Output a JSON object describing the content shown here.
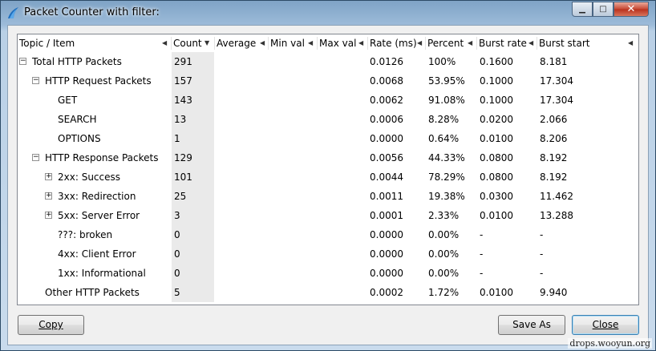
{
  "window": {
    "title": "Packet Counter with filter:",
    "controls": {
      "minimize": "▁",
      "maximize": "□",
      "close": "✕"
    }
  },
  "columns": [
    {
      "label": "Topic / Item"
    },
    {
      "label": "Count"
    },
    {
      "label": "Average"
    },
    {
      "label": "Min val"
    },
    {
      "label": "Max val"
    },
    {
      "label": "Rate (ms)"
    },
    {
      "label": "Percent"
    },
    {
      "label": "Burst rate"
    },
    {
      "label": "Burst start"
    }
  ],
  "rows": [
    {
      "expander": "minus",
      "topic": "Total HTTP Packets",
      "count": "291",
      "rate": "0.0126",
      "percent": "100%",
      "burst_rate": "0.1600",
      "burst_start": "8.181"
    },
    {
      "expander": "minus",
      "topic": "HTTP Request Packets",
      "count": "157",
      "rate": "0.0068",
      "percent": "53.95%",
      "burst_rate": "0.1000",
      "burst_start": "17.304"
    },
    {
      "expander": "",
      "topic": "GET",
      "count": "143",
      "rate": "0.0062",
      "percent": "91.08%",
      "burst_rate": "0.1000",
      "burst_start": "17.304"
    },
    {
      "expander": "",
      "topic": "SEARCH",
      "count": "13",
      "rate": "0.0006",
      "percent": "8.28%",
      "burst_rate": "0.0200",
      "burst_start": "2.066"
    },
    {
      "expander": "",
      "topic": "OPTIONS",
      "count": "1",
      "rate": "0.0000",
      "percent": "0.64%",
      "burst_rate": "0.0100",
      "burst_start": "8.206"
    },
    {
      "expander": "minus",
      "topic": "HTTP Response Packets",
      "count": "129",
      "rate": "0.0056",
      "percent": "44.33%",
      "burst_rate": "0.0800",
      "burst_start": "8.192"
    },
    {
      "expander": "plus",
      "topic": "2xx: Success",
      "count": "101",
      "rate": "0.0044",
      "percent": "78.29%",
      "burst_rate": "0.0800",
      "burst_start": "8.192"
    },
    {
      "expander": "plus",
      "topic": "3xx: Redirection",
      "count": "25",
      "rate": "0.0011",
      "percent": "19.38%",
      "burst_rate": "0.0300",
      "burst_start": "11.462"
    },
    {
      "expander": "plus",
      "topic": "5xx: Server Error",
      "count": "3",
      "rate": "0.0001",
      "percent": "2.33%",
      "burst_rate": "0.0100",
      "burst_start": "13.288"
    },
    {
      "expander": "",
      "topic": "???: broken",
      "count": "0",
      "rate": "0.0000",
      "percent": "0.00%",
      "burst_rate": "-",
      "burst_start": "-"
    },
    {
      "expander": "",
      "topic": "4xx: Client Error",
      "count": "0",
      "rate": "0.0000",
      "percent": "0.00%",
      "burst_rate": "-",
      "burst_start": "-"
    },
    {
      "expander": "",
      "topic": "1xx: Informational",
      "count": "0",
      "rate": "0.0000",
      "percent": "0.00%",
      "burst_rate": "-",
      "burst_start": "-"
    },
    {
      "expander": "",
      "topic": "Other HTTP Packets",
      "count": "5",
      "rate": "0.0002",
      "percent": "1.72%",
      "burst_rate": "0.0100",
      "burst_start": "9.940"
    }
  ],
  "buttons": {
    "copy": "Copy",
    "save_as": "Save As",
    "close": "Close"
  },
  "watermark": "drops.wooyun.org"
}
